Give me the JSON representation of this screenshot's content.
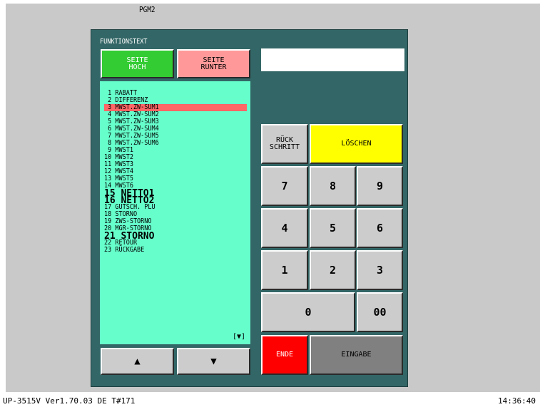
{
  "window": {
    "title": "PGM2"
  },
  "panel": {
    "label": "FUNKTIONSTEXT"
  },
  "buttons": {
    "page_up": "SEITE\nHOCH",
    "page_down": "SEITE\nRUNTER",
    "backspace": "RÜCK\nSCHRITT",
    "clear": "LÖSCHEN",
    "end": "ENDE",
    "enter": "EINGABE",
    "arrow_up": "▲",
    "arrow_down": "▼"
  },
  "keypad": [
    "7",
    "8",
    "9",
    "4",
    "5",
    "6",
    "1",
    "2",
    "3",
    "0",
    "00"
  ],
  "list": {
    "more_indicator": "[▼]",
    "selected_index": 2,
    "items": [
      " 1 RABATT",
      " 2 DIFFERENZ",
      " 3 MWST.ZW-SUM1",
      " 4 MWST.ZW-SUM2",
      " 5 MWST.ZW-SUM3",
      " 6 MWST.ZW-SUM4",
      " 7 MWST.ZW-SUM5",
      " 8 MWST.ZW-SUM6",
      " 9 MWST1",
      "10 MWST2",
      "11 MWST3",
      "12 MWST4",
      "13 MWST5",
      "14 MWST6",
      "15 NETTO1",
      "16 NETTO2",
      "17 GUTSCH. PLU",
      "18 STORNO",
      "19 ZWS-STORNO",
      "20 MGR-STORNO",
      "21 STORNO",
      "22 RETOUR",
      "23 RÜCKGABE"
    ],
    "large_items": [
      14,
      15,
      20
    ]
  },
  "display": {
    "value": ""
  },
  "status": {
    "left": "UP-3515V  Ver1.70.03 DE T#171",
    "right": "14:36:40"
  },
  "colors": {
    "panel": "#336666",
    "list": "#66ffcc",
    "selected": "#ff6666",
    "page_up": "#33cc33",
    "page_down": "#ff9999",
    "clear": "#ffff00",
    "end": "#ff0000",
    "enter": "#808080"
  }
}
